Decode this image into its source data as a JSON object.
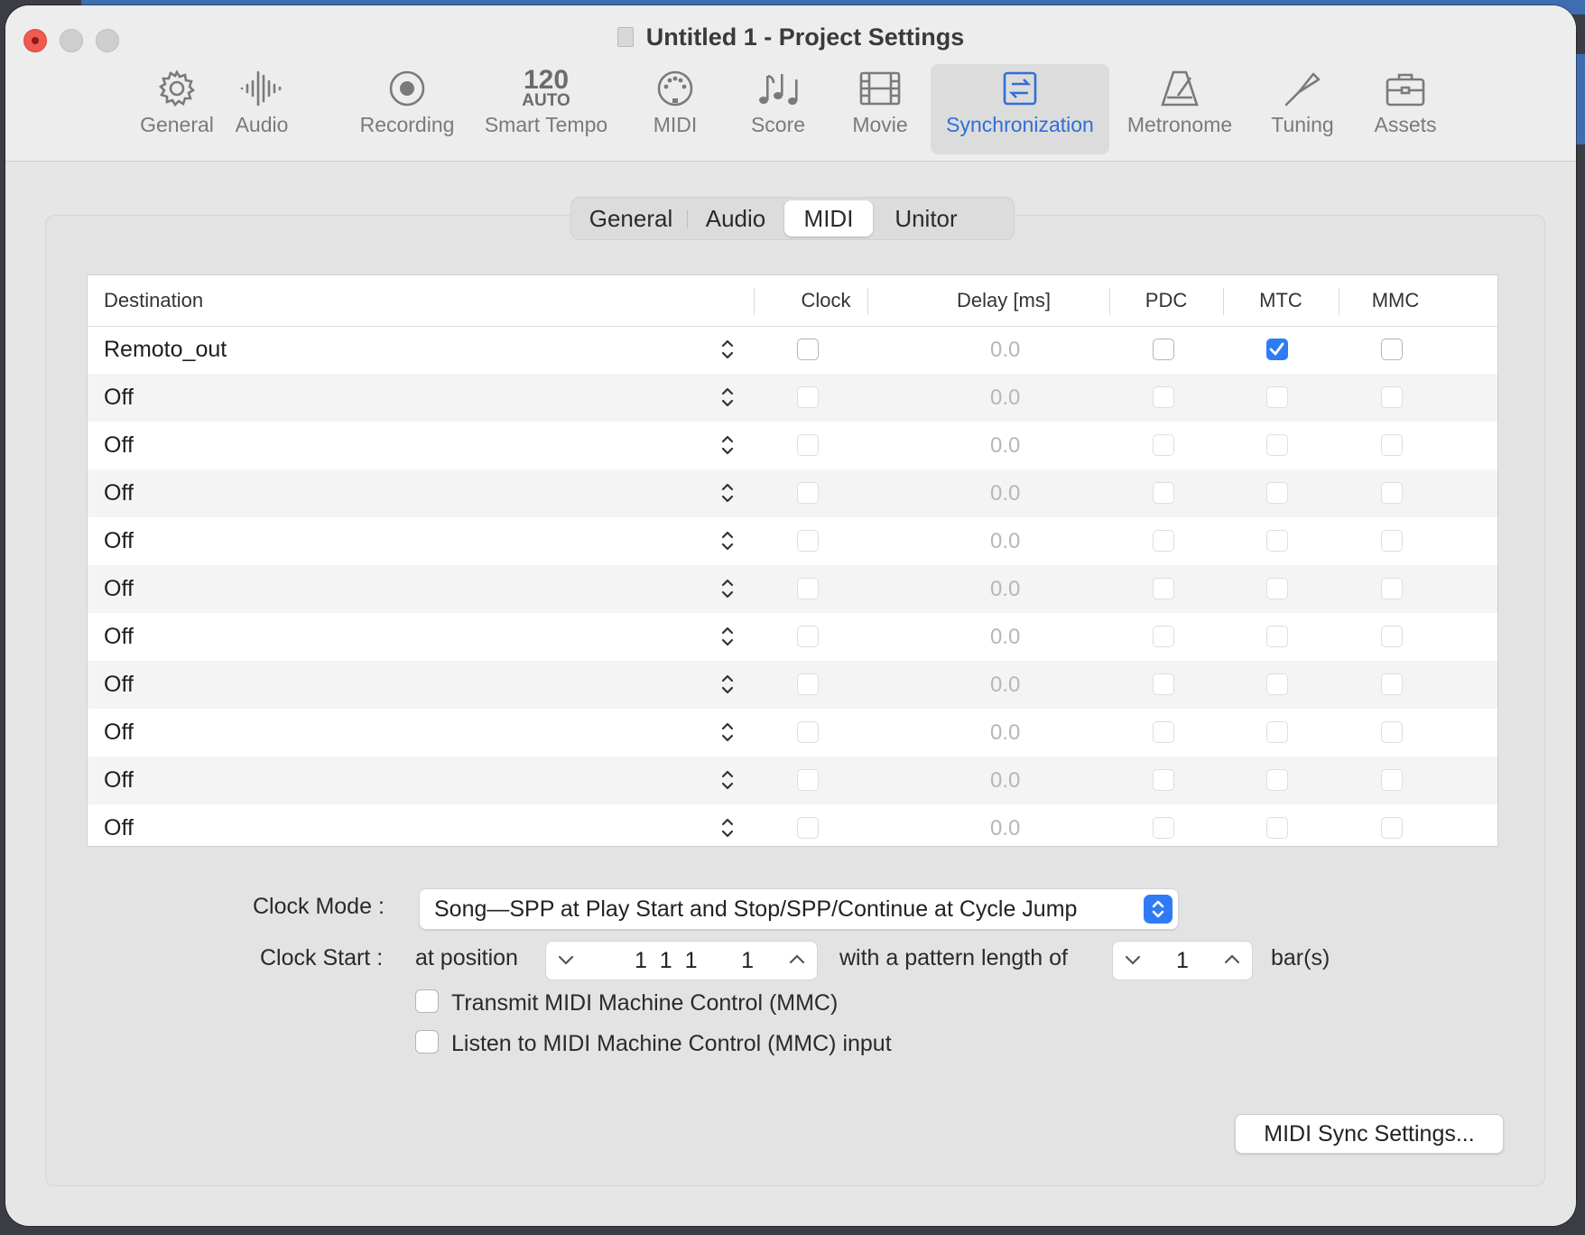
{
  "window": {
    "title": "Untitled 1 - Project Settings"
  },
  "toolbar": {
    "items": [
      {
        "label": "General",
        "icon": "gear-icon"
      },
      {
        "label": "Audio",
        "icon": "waveform-icon"
      },
      {
        "label": "Recording",
        "icon": "record-icon"
      },
      {
        "label": "Smart Tempo",
        "icon": "tempo-icon",
        "tempo": "120",
        "tempo_mode": "AUTO"
      },
      {
        "label": "MIDI",
        "icon": "midi-connector-icon"
      },
      {
        "label": "Score",
        "icon": "music-notes-icon"
      },
      {
        "label": "Movie",
        "icon": "film-icon"
      },
      {
        "label": "Synchronization",
        "icon": "sync-icon",
        "selected": true
      },
      {
        "label": "Metronome",
        "icon": "metronome-icon"
      },
      {
        "label": "Tuning",
        "icon": "tuning-fork-icon"
      },
      {
        "label": "Assets",
        "icon": "briefcase-icon"
      }
    ]
  },
  "tabs": [
    {
      "label": "General"
    },
    {
      "label": "Audio"
    },
    {
      "label": "MIDI",
      "selected": true
    },
    {
      "label": "Unitor"
    }
  ],
  "table": {
    "headers": {
      "destination": "Destination",
      "clock": "Clock",
      "delay": "Delay [ms]",
      "pdc": "PDC",
      "mtc": "MTC",
      "mmc": "MMC"
    },
    "rows": [
      {
        "destination": "Remoto_out",
        "delay": "0.0",
        "clock": false,
        "pdc": false,
        "mtc": true,
        "mmc": false,
        "enabled": true
      },
      {
        "destination": "Off",
        "delay": "0.0",
        "clock": false,
        "pdc": false,
        "mtc": false,
        "mmc": false,
        "enabled": false
      },
      {
        "destination": "Off",
        "delay": "0.0",
        "clock": false,
        "pdc": false,
        "mtc": false,
        "mmc": false,
        "enabled": false
      },
      {
        "destination": "Off",
        "delay": "0.0",
        "clock": false,
        "pdc": false,
        "mtc": false,
        "mmc": false,
        "enabled": false
      },
      {
        "destination": "Off",
        "delay": "0.0",
        "clock": false,
        "pdc": false,
        "mtc": false,
        "mmc": false,
        "enabled": false
      },
      {
        "destination": "Off",
        "delay": "0.0",
        "clock": false,
        "pdc": false,
        "mtc": false,
        "mmc": false,
        "enabled": false
      },
      {
        "destination": "Off",
        "delay": "0.0",
        "clock": false,
        "pdc": false,
        "mtc": false,
        "mmc": false,
        "enabled": false
      },
      {
        "destination": "Off",
        "delay": "0.0",
        "clock": false,
        "pdc": false,
        "mtc": false,
        "mmc": false,
        "enabled": false
      },
      {
        "destination": "Off",
        "delay": "0.0",
        "clock": false,
        "pdc": false,
        "mtc": false,
        "mmc": false,
        "enabled": false
      },
      {
        "destination": "Off",
        "delay": "0.0",
        "clock": false,
        "pdc": false,
        "mtc": false,
        "mmc": false,
        "enabled": false
      },
      {
        "destination": "Off",
        "delay": "0.0",
        "clock": false,
        "pdc": false,
        "mtc": false,
        "mmc": false,
        "enabled": false
      }
    ]
  },
  "clock_mode": {
    "label": "Clock Mode :",
    "value": "Song—SPP at Play Start and Stop/SPP/Continue at Cycle Jump"
  },
  "clock_start": {
    "label": "Clock Start :",
    "at_position_label": "at position",
    "position": "1  1  1       1",
    "pattern_label": "with a pattern length of",
    "pattern_length": "1",
    "unit": "bar(s)"
  },
  "options": {
    "transmit_mmc": {
      "label": "Transmit MIDI Machine Control (MMC)",
      "checked": false
    },
    "listen_mmc": {
      "label": "Listen to MIDI Machine Control (MMC) input",
      "checked": false
    }
  },
  "buttons": {
    "midi_sync_settings": "MIDI Sync Settings..."
  },
  "colors": {
    "accent": "#2f7bf5",
    "close": "#ee5a52",
    "active_label": "#2f6fd6"
  }
}
